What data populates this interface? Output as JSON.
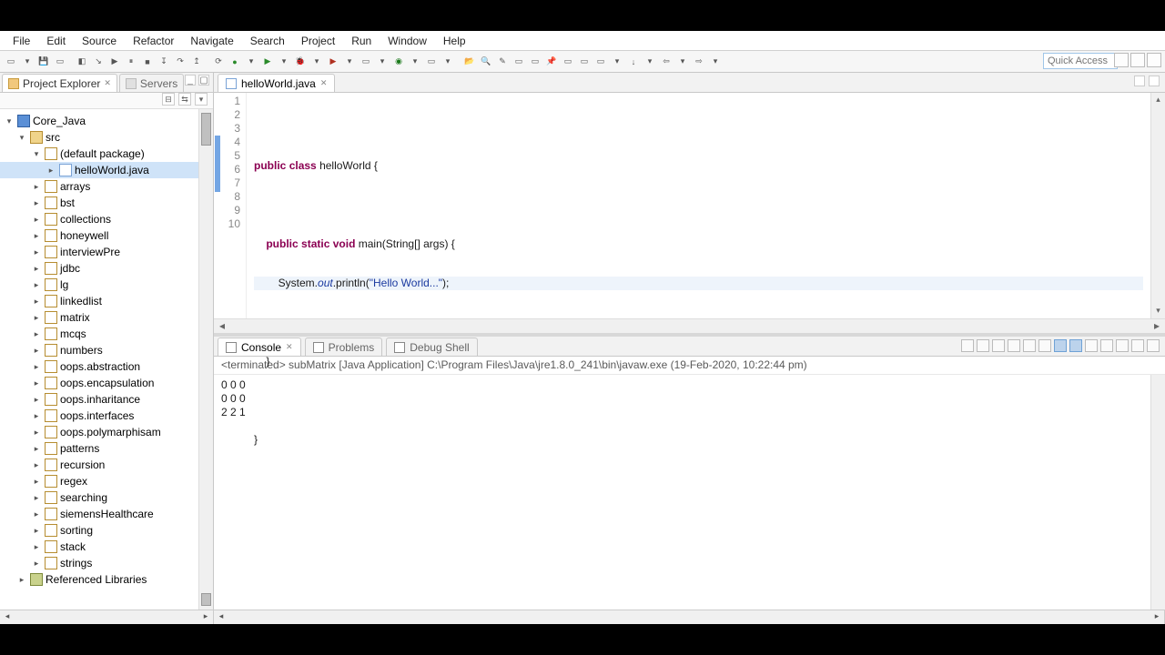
{
  "menu": [
    "File",
    "Edit",
    "Source",
    "Refactor",
    "Navigate",
    "Search",
    "Project",
    "Run",
    "Window",
    "Help"
  ],
  "quick_access_placeholder": "Quick Access",
  "left_panel": {
    "tabs": [
      {
        "label": "Project Explorer",
        "active": true
      },
      {
        "label": "Servers",
        "active": false
      }
    ],
    "project": "Core_Java",
    "src": "src",
    "default_pkg": "(default package)",
    "file": "helloWorld.java",
    "packages": [
      "arrays",
      "bst",
      "collections",
      "honeywell",
      "interviewPre",
      "jdbc",
      "lg",
      "linkedlist",
      "matrix",
      "mcqs",
      "numbers",
      "oops.abstraction",
      "oops.encapsulation",
      "oops.inharitance",
      "oops.interfaces",
      "oops.polymarphisam",
      "patterns",
      "recursion",
      "regex",
      "searching",
      "siemensHealthcare",
      "sorting",
      "stack",
      "strings"
    ],
    "ref_lib": "Referenced Libraries"
  },
  "editor": {
    "tab": "helloWorld.java",
    "lines": [
      "1",
      "2",
      "3",
      "4",
      "5",
      "6",
      "7",
      "8",
      "9",
      "10"
    ],
    "code": {
      "l2_kw1": "public",
      "l2_kw2": "class",
      "l2_cls": "helloWorld {",
      "l4_kw1": "public",
      "l4_kw2": "static",
      "l4_kw3": "void",
      "l4_rest": "main(String[] args) {",
      "l5_pre": "        System.",
      "l5_out": "out",
      "l5_mid": ".println(",
      "l5_str": "\"Hello World...\"",
      "l5_end": ");",
      "l7": "    }",
      "l9": "}"
    }
  },
  "console": {
    "tabs": [
      {
        "label": "Console",
        "active": true
      },
      {
        "label": "Problems",
        "active": false
      },
      {
        "label": "Debug Shell",
        "active": false
      }
    ],
    "term_line": "<terminated> subMatrix [Java Application] C:\\Program Files\\Java\\jre1.8.0_241\\bin\\javaw.exe (19-Feb-2020, 10:22:44 pm)",
    "output": "0 0 0\n0 0 0\n2 2 1"
  }
}
